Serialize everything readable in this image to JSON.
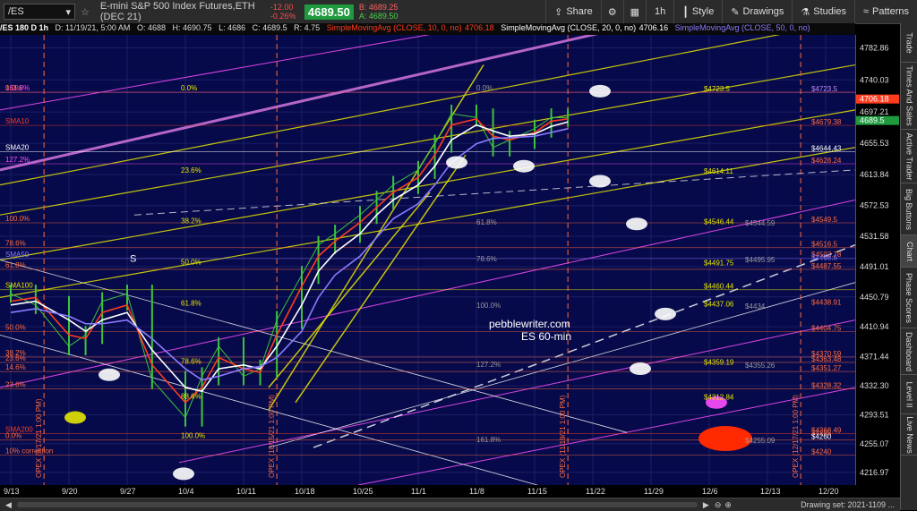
{
  "topbar": {
    "symbol": "/ES",
    "description": "E-mini S&P 500 Index Futures,ETH (DEC 21)",
    "change": "-12.00",
    "change_pct": "-0.26%",
    "last": "4689.50",
    "bid": "B: 4689.25",
    "ask": "A: 4689.50",
    "buttons": {
      "share": "Share",
      "interval": "1h",
      "style": "Style",
      "drawings": "Drawings",
      "studies": "Studies",
      "patterns": "Patterns"
    }
  },
  "infobar": {
    "title": "/ES 180 D 1h",
    "datetime": "D: 11/19/21, 5:00 AM",
    "open": "O: 4688",
    "high": "H: 4690.75",
    "low": "L: 4686",
    "close": "C: 4689.5",
    "range": "R: 4.75",
    "sma10_label": "SimpleMovingAvg (CLOSE, 10, 0, no)",
    "sma10_value": "4706.18",
    "sma20_label": "SimpleMovingAvg (CLOSE, 20, 0, no)",
    "sma20_value": "4706.16",
    "sma50_label": "SimpleMovingAvg (CLOSE, 50, 0, no)"
  },
  "colors": {
    "background": "#070a4a",
    "price_bars": "#3cc43c",
    "sma10": "#ff3b1f",
    "sma20": "#ffffff",
    "sma50": "#8a7bff",
    "channel_yellow": "#e6e600",
    "channel_magenta": "#ff4fff",
    "level_orange": "#ff6a3d",
    "last_price_bg": "#1f9a3e"
  },
  "side_tabs": [
    "Trade",
    "Times And Sales",
    "Active Trader",
    "Big Buttons",
    "Chart",
    "Phase Scores",
    "Dashboard",
    "Level II",
    "Live News"
  ],
  "watermark": {
    "line1": "pebblewriter.com",
    "line2": "ES 60-min"
  },
  "status": {
    "drawing_set": "Drawing set: 2021-1109 ..."
  },
  "chart_data": {
    "type": "line",
    "title": "/ES 180 D 1h",
    "x_ticks": [
      "9/13",
      "9/20",
      "9/27",
      "10/4",
      "10/11",
      "10/18",
      "10/25",
      "11/1",
      "11/8",
      "11/15",
      "11/22",
      "11/29",
      "12/6",
      "12/13",
      "12/20"
    ],
    "y_ticks": [
      4782.86,
      4740.03,
      4697.21,
      4655.53,
      4613.84,
      4572.53,
      4531.58,
      4491.01,
      4450.79,
      4410.94,
      4371.44,
      4332.3,
      4293.51,
      4255.07,
      4216.97
    ],
    "ylim": [
      4200,
      4800
    ],
    "series": [
      {
        "name": "/ES",
        "x": [
          "9/13",
          "9/16",
          "9/20",
          "9/22",
          "9/24",
          "9/27",
          "9/30",
          "10/4",
          "10/6",
          "10/8",
          "10/11",
          "10/13",
          "10/15",
          "10/18",
          "10/20",
          "10/22",
          "10/25",
          "10/27",
          "10/29",
          "11/1",
          "11/3",
          "11/5",
          "11/8",
          "11/10",
          "11/12",
          "11/15",
          "11/17",
          "11/19"
        ],
        "values": [
          4455,
          4440,
          4385,
          4400,
          4445,
          4455,
          4340,
          4290,
          4345,
          4385,
          4345,
          4355,
          4420,
          4480,
          4520,
          4535,
          4560,
          4580,
          4600,
          4620,
          4655,
          4695,
          4690,
          4650,
          4660,
          4675,
          4690,
          4689.5
        ]
      },
      {
        "name": "SMA10",
        "values": [
          4445,
          4450,
          4400,
          4395,
          4430,
          4440,
          4360,
          4310,
          4330,
          4370,
          4355,
          4350,
          4400,
          4465,
          4505,
          4525,
          4550,
          4570,
          4590,
          4610,
          4640,
          4680,
          4688,
          4665,
          4660,
          4670,
          4685,
          4688
        ]
      },
      {
        "name": "SMA20",
        "values": [
          4440,
          4445,
          4420,
          4405,
          4420,
          4430,
          4380,
          4330,
          4325,
          4355,
          4360,
          4355,
          4385,
          4440,
          4485,
          4510,
          4535,
          4560,
          4580,
          4600,
          4625,
          4660,
          4680,
          4672,
          4665,
          4668,
          4678,
          4684
        ]
      },
      {
        "name": "SMA50",
        "values": [
          4430,
          4435,
          4425,
          4415,
          4415,
          4420,
          4395,
          4355,
          4340,
          4345,
          4355,
          4358,
          4370,
          4405,
          4450,
          4480,
          4505,
          4530,
          4555,
          4575,
          4600,
          4630,
          4655,
          4662,
          4663,
          4665,
          4670,
          4675
        ]
      }
    ],
    "right_axis_labels": [
      {
        "value": 4706.18,
        "text": "4706.18",
        "color": "#ff3b1f"
      },
      {
        "value": 4689.5,
        "text": "4689.5",
        "color": "#1f9a3e"
      }
    ],
    "left_labels": [
      {
        "value": 4723.5,
        "text": "161.8%",
        "color": "#ff4fff"
      },
      {
        "value": 4723.5,
        "text": "0.0%",
        "color": "#ff6a3d"
      },
      {
        "value": 4679.38,
        "text": "SMA10",
        "color": "#ff3b1f"
      },
      {
        "value": 4644.43,
        "text": "SMA20",
        "color": "#ffffff"
      },
      {
        "value": 4628.24,
        "text": "127.2%",
        "color": "#ff4fff"
      },
      {
        "value": 4549.5,
        "text": "100.0%",
        "color": "#ff6a3d"
      },
      {
        "value": 4516.5,
        "text": "78.6%",
        "color": "#ff6a3d"
      },
      {
        "value": 4502,
        "text": "SMA50",
        "color": "#8a7bff"
      },
      {
        "value": 4487.55,
        "text": "61.8%",
        "color": "#ff6a3d"
      },
      {
        "value": 4460.44,
        "text": "SMA100",
        "color": "#e6e600"
      },
      {
        "value": 4404.75,
        "text": "50.0%",
        "color": "#ff6a3d"
      },
      {
        "value": 4370.59,
        "text": "38.2%",
        "color": "#ff6a3d"
      },
      {
        "value": 4363.48,
        "text": "23.6%",
        "color": "#ff6a3d"
      },
      {
        "value": 4351.27,
        "text": "14.6%",
        "color": "#ff6a3d"
      },
      {
        "value": 4328.32,
        "text": "23.6%",
        "color": "#ff6a3d"
      },
      {
        "value": 4268.49,
        "text": "SMA200",
        "color": "#ff3b1f"
      },
      {
        "value": 4260,
        "text": "0.0%",
        "color": "#ff6a3d"
      },
      {
        "value": 4240,
        "text": "10% correction",
        "color": "#ff6a3d"
      }
    ],
    "right_labels": [
      {
        "value": 4723.5,
        "text": "$4723.5",
        "color": "#e6e600"
      },
      {
        "value": 4723.5,
        "text": "$4723.5",
        "color": "#ff6a3d"
      },
      {
        "value": 4723.5,
        "text": "$4723.5",
        "color": "#8a7bff"
      },
      {
        "value": 4679.38,
        "text": "$4679.38",
        "color": "#ff6a3d"
      },
      {
        "value": 4644.43,
        "text": "$4644.43",
        "color": "#ffffff"
      },
      {
        "value": 4628.24,
        "text": "$4628.24",
        "color": "#ff6a3d"
      },
      {
        "value": 4614.11,
        "text": "$4614.11",
        "color": "#e6e600"
      },
      {
        "value": 4549.5,
        "text": "$4549.5",
        "color": "#ff6a3d"
      },
      {
        "value": 4546.44,
        "text": "$4546.44",
        "color": "#e6e600"
      },
      {
        "value": 4544.59,
        "text": "$4544.59",
        "color": "#999999"
      },
      {
        "value": 4516.5,
        "text": "$4516.5",
        "color": "#ff6a3d"
      },
      {
        "value": 4502.78,
        "text": "$4502.78",
        "color": "#ff6a3d"
      },
      {
        "value": 4498.6,
        "text": "$4498.6",
        "color": "#8a7bff"
      },
      {
        "value": 4495.95,
        "text": "$4495.95",
        "color": "#999999"
      },
      {
        "value": 4491.75,
        "text": "$4491.75",
        "color": "#e6e600"
      },
      {
        "value": 4487.55,
        "text": "$4487.55",
        "color": "#ff6a3d"
      },
      {
        "value": 4460.44,
        "text": "$4460.44",
        "color": "#e6e600"
      },
      {
        "value": 4438.91,
        "text": "$4438.91",
        "color": "#ff6a3d"
      },
      {
        "value": 4437.06,
        "text": "$4437.06",
        "color": "#e6e600"
      },
      {
        "value": 4434,
        "text": "$4434",
        "color": "#999999"
      },
      {
        "value": 4404.75,
        "text": "$4404.75",
        "color": "#ff6a3d"
      },
      {
        "value": 4370.59,
        "text": "$4370.59",
        "color": "#ff6a3d"
      },
      {
        "value": 4363.48,
        "text": "$4363.48",
        "color": "#ff6a3d"
      },
      {
        "value": 4359.19,
        "text": "$4359.19",
        "color": "#e6e600"
      },
      {
        "value": 4355.26,
        "text": "$4355.26",
        "color": "#999999"
      },
      {
        "value": 4351.27,
        "text": "$4351.27",
        "color": "#ff6a3d"
      },
      {
        "value": 4328.32,
        "text": "$4328.32",
        "color": "#ff6a3d"
      },
      {
        "value": 4312.84,
        "text": "$4312.84",
        "color": "#e6e600"
      },
      {
        "value": 4268.49,
        "text": "$4268.49",
        "color": "#ff6a3d"
      },
      {
        "value": 4265,
        "text": "$4265",
        "color": "#ff6a3d"
      },
      {
        "value": 4260,
        "text": "$4260",
        "color": "#ffffff"
      },
      {
        "value": 4255.09,
        "text": "$4255.09",
        "color": "#999999"
      },
      {
        "value": 4240,
        "text": "$4240",
        "color": "#ff6a3d"
      }
    ],
    "fib_labels": [
      {
        "text": "0.0%",
        "color": "#e6e600"
      },
      {
        "text": "23.6%",
        "color": "#e6e600"
      },
      {
        "text": "38.2%",
        "color": "#e6e600"
      },
      {
        "text": "50.0%",
        "color": "#e6e600"
      },
      {
        "text": "61.8%",
        "color": "#e6e600"
      },
      {
        "text": "78.6%",
        "color": "#e6e600"
      },
      {
        "text": "88.6%",
        "color": "#e6e600"
      },
      {
        "text": "100.0%",
        "color": "#e6e600"
      },
      {
        "text": "0.0%",
        "color": "#999999"
      },
      {
        "text": "61.8%",
        "color": "#999999"
      },
      {
        "text": "78.6%",
        "color": "#999999"
      },
      {
        "text": "100.0%",
        "color": "#999999"
      },
      {
        "text": "127.2%",
        "color": "#999999"
      },
      {
        "text": "161.8%",
        "color": "#999999"
      },
      {
        "text": "S",
        "color": "#ffffff"
      }
    ],
    "vertical_markers": [
      {
        "x": "9/17",
        "text": "OPEX (9/17/21 1:00 PM)"
      },
      {
        "x": "10/15",
        "text": "OPEX (10/15/21 1:00 PM)"
      },
      {
        "x": "11/19",
        "text": "OPEX (11/19/21 1:00 PM)"
      },
      {
        "x": "12/17",
        "text": "OPEX (12/17/21 1:00 PM)"
      }
    ]
  }
}
